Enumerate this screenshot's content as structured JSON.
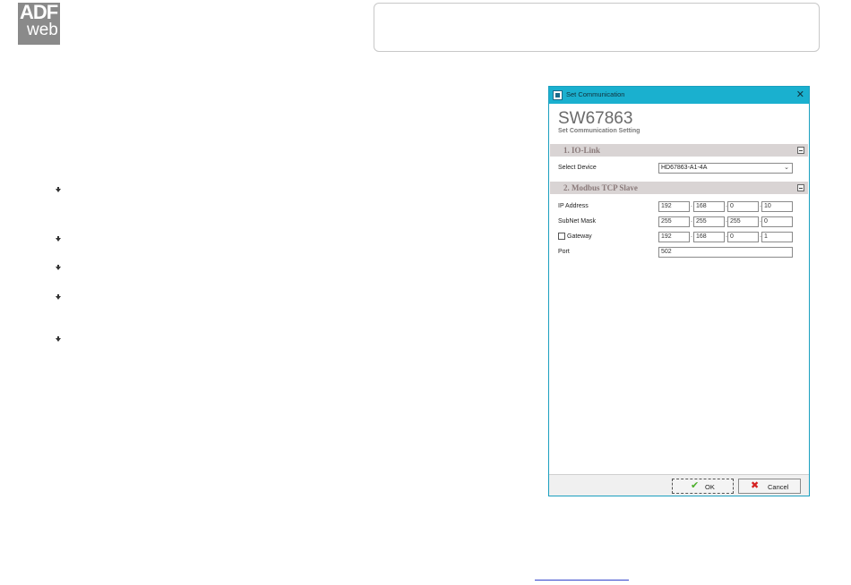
{
  "logo": {
    "line1": "ADF",
    "line2": "web"
  },
  "dialog": {
    "window_title": "Set Communication",
    "close_glyph": "✕",
    "app_title": "SW67863",
    "app_subtitle": "Set Communication Setting",
    "sections": [
      {
        "label": "1. IO-Link"
      },
      {
        "label": "2. Modbus TCP Slave"
      }
    ],
    "io_link": {
      "select_device_label": "Select Device",
      "select_device_value": "HD67863-A1-4A"
    },
    "modbus": {
      "ip_label": "IP Address",
      "ip": [
        "192",
        "168",
        "0",
        "10"
      ],
      "subnet_label": "SubNet Mask",
      "subnet": [
        "255",
        "255",
        "255",
        "0"
      ],
      "gateway_label": "Gateway",
      "gateway_checked": false,
      "gateway": [
        "192",
        "168",
        "0",
        "1"
      ],
      "port_label": "Port",
      "port": "502"
    },
    "buttons": {
      "ok_label": "OK",
      "cancel_label": "Cancel"
    }
  },
  "icons": {
    "bullet": "arrow-down-bullet-icon",
    "ok": "check-icon",
    "cancel": "x-icon",
    "app": "window-app-icon"
  },
  "colors": {
    "titlebar": "#1ab0cf",
    "section_bg": "#d9d4d4",
    "logo_bg": "#8a8a8a"
  }
}
